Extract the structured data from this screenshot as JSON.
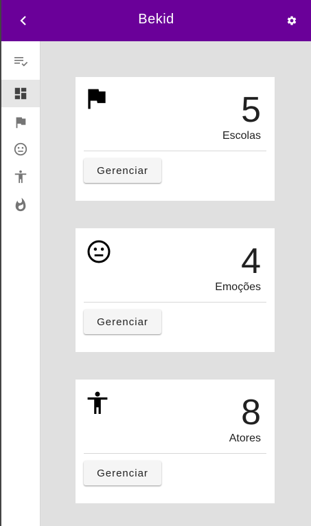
{
  "appbar": {
    "title": "Bekid",
    "back_icon": "chevron-left-icon",
    "settings_icon": "gear-icon"
  },
  "sidebar": {
    "items": [
      {
        "icon": "list-check-icon"
      },
      {
        "icon": "dashboard-icon",
        "active": true
      },
      {
        "icon": "flag-icon"
      },
      {
        "icon": "emoticon-neutral-icon"
      },
      {
        "icon": "human-icon"
      },
      {
        "icon": "fire-icon"
      }
    ]
  },
  "cards": [
    {
      "icon": "flag-icon",
      "count": "5",
      "label": "Escolas",
      "button": "Gerenciar"
    },
    {
      "icon": "emoticon-neutral-icon",
      "count": "4",
      "label": "Emoções",
      "button": "Gerenciar"
    },
    {
      "icon": "human-icon",
      "count": "8",
      "label": "Atores",
      "button": "Gerenciar"
    }
  ],
  "colors": {
    "primary": "#6a0099",
    "background": "#e0e0e0",
    "card": "#ffffff",
    "icon_muted": "#757575"
  }
}
